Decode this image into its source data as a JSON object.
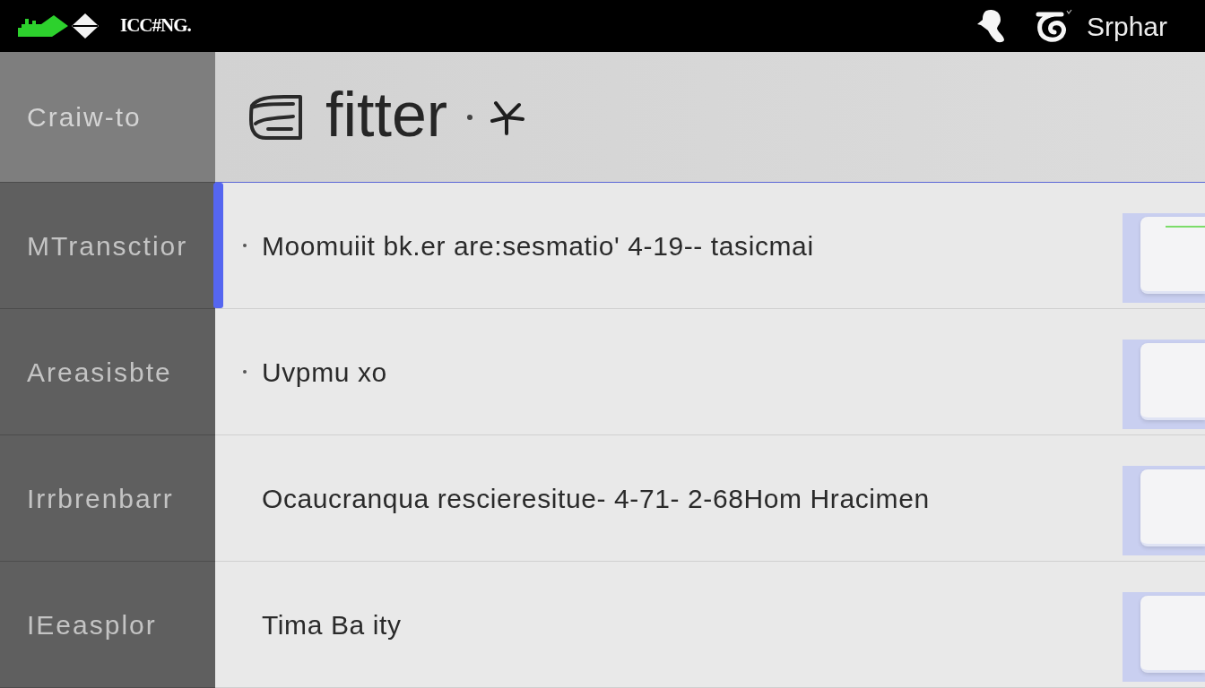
{
  "top_bar": {
    "left_text": "ICC#NG.",
    "right_text": "Srphar"
  },
  "sidebar": {
    "items": [
      {
        "label": "Craiw-to",
        "selected": true
      },
      {
        "label": "MTransctior",
        "selected": false
      },
      {
        "label": "Areasisbte",
        "selected": false
      },
      {
        "label": "Irrbrenbarr",
        "selected": false
      },
      {
        "label": "IEeasplor",
        "selected": false
      }
    ]
  },
  "header": {
    "title": "fitter"
  },
  "list": {
    "rows": [
      {
        "text": "Moomuiit bk.er are:sesmatio' 4-19-- tasicmai",
        "bullet": true,
        "selected": true,
        "on": true
      },
      {
        "text": "Uvpmu xo",
        "bullet": true,
        "selected": false,
        "on": false
      },
      {
        "text": "Ocaucranqua rescieresitue- 4-71- 2-68Hom Hracimen",
        "bullet": false,
        "selected": false,
        "on": false
      },
      {
        "text": "Tima Ba ity",
        "bullet": false,
        "selected": false,
        "on": false
      }
    ]
  }
}
